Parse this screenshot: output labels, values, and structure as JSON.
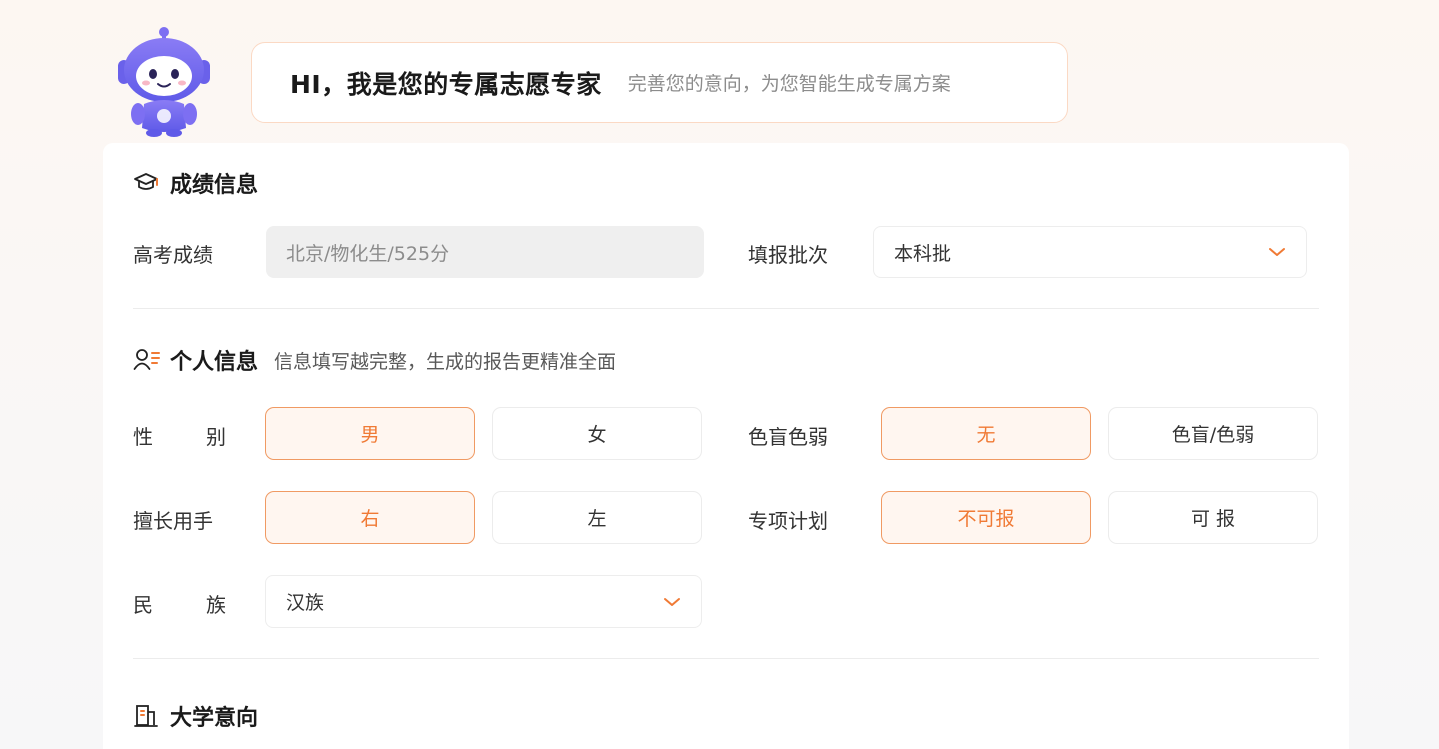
{
  "greeting": {
    "title": "HI，我是您的专属志愿专家",
    "subtitle": "完善您的意向，为您智能生成专属方案"
  },
  "colors": {
    "accent": "#f07a35",
    "accent_border": "#f09a63",
    "accent_bg": "#fff6f0"
  },
  "score_section": {
    "title": "成绩信息",
    "icon": "graduation-cap-icon",
    "exam_label": "高考成绩",
    "exam_value": "北京/物化生/525分",
    "batch_label": "填报批次",
    "batch_value": "本科批"
  },
  "personal_section": {
    "title": "个人信息",
    "icon": "user-list-icon",
    "hint": "信息填写越完整，生成的报告更精准全面",
    "gender": {
      "label_a": "性",
      "label_b": "别",
      "options": [
        "男",
        "女"
      ],
      "selected": "男"
    },
    "colorblind": {
      "label": "色盲色弱",
      "options": [
        "无",
        "色盲/色弱"
      ],
      "selected": "无"
    },
    "hand": {
      "label": "擅长用手",
      "options": [
        "右",
        "左"
      ],
      "selected": "右"
    },
    "special_plan": {
      "label": "专项计划",
      "options": [
        "不可报",
        "可 报"
      ],
      "selected": "不可报"
    },
    "ethnicity": {
      "label_a": "民",
      "label_b": "族",
      "value": "汉族"
    }
  },
  "university_section": {
    "title": "大学意向",
    "icon": "building-icon"
  }
}
